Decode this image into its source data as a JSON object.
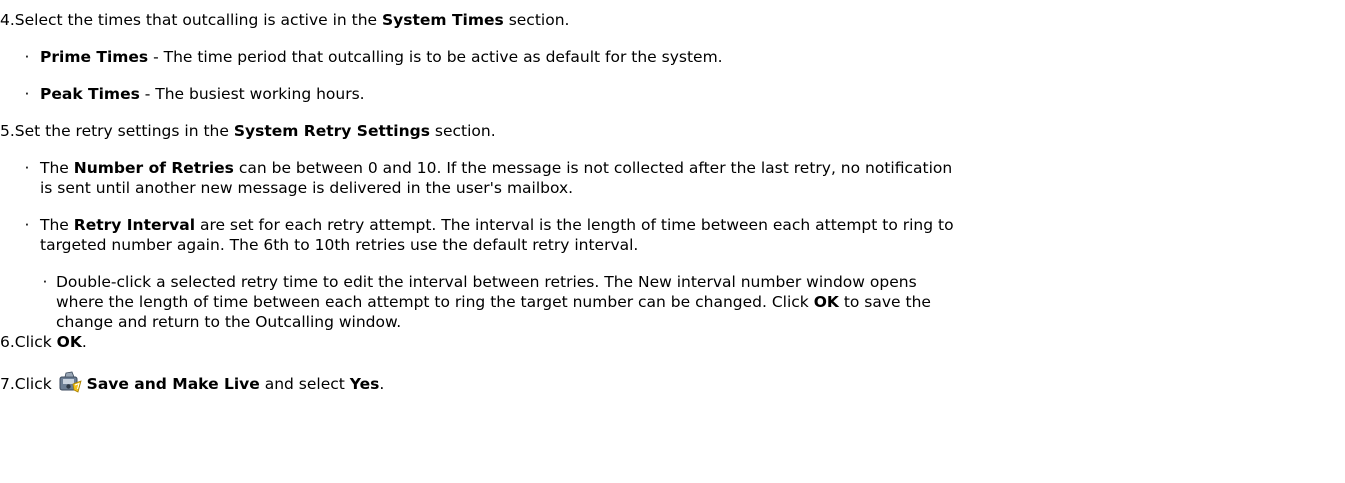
{
  "step4": {
    "num": "4.",
    "pre": "Select the times that outcalling is active in the ",
    "bold": "System Times",
    "post": " section.",
    "bullets": [
      {
        "bold": "Prime Times",
        "text": " - The time period that outcalling is to be active as default for the system."
      },
      {
        "bold": "Peak Times",
        "text": " - The busiest working hours."
      }
    ]
  },
  "step5": {
    "num": "5.",
    "pre": "Set the retry settings in the ",
    "bold": "System Retry Settings",
    "post": " section.",
    "bullet1": {
      "pre": "The ",
      "bold": "Number of Retries",
      "line1_rest": " can be between 0 and 10. If the message is not collected after the last retry, no notification",
      "line2": "is sent until another new message is delivered in the user's mailbox."
    },
    "bullet2": {
      "pre": "The ",
      "bold": "Retry Interval",
      "line1_rest": " are set for each retry attempt. The interval is the length of time between each attempt to ring to",
      "line2": "targeted number again. The 6th to 10th retries use the default retry interval."
    },
    "sub_bullet": {
      "line1": "Double-click a selected retry time to edit the interval between retries. The New interval number window opens",
      "line2": "where the length of time between each attempt to ring the target number can be changed. Click ",
      "line2_bold": "OK",
      "line2_post": " to save the",
      "line3": "change and return to the Outcalling window."
    }
  },
  "step6": {
    "num": "6.",
    "pre": "Click ",
    "bold": "OK",
    "post": "."
  },
  "step7": {
    "num": "7.",
    "pre": "Click ",
    "icon": "save-and-make-live-icon",
    "bold": "Save and Make Live",
    "mid": " and select ",
    "bold2": "Yes",
    "post": "."
  }
}
